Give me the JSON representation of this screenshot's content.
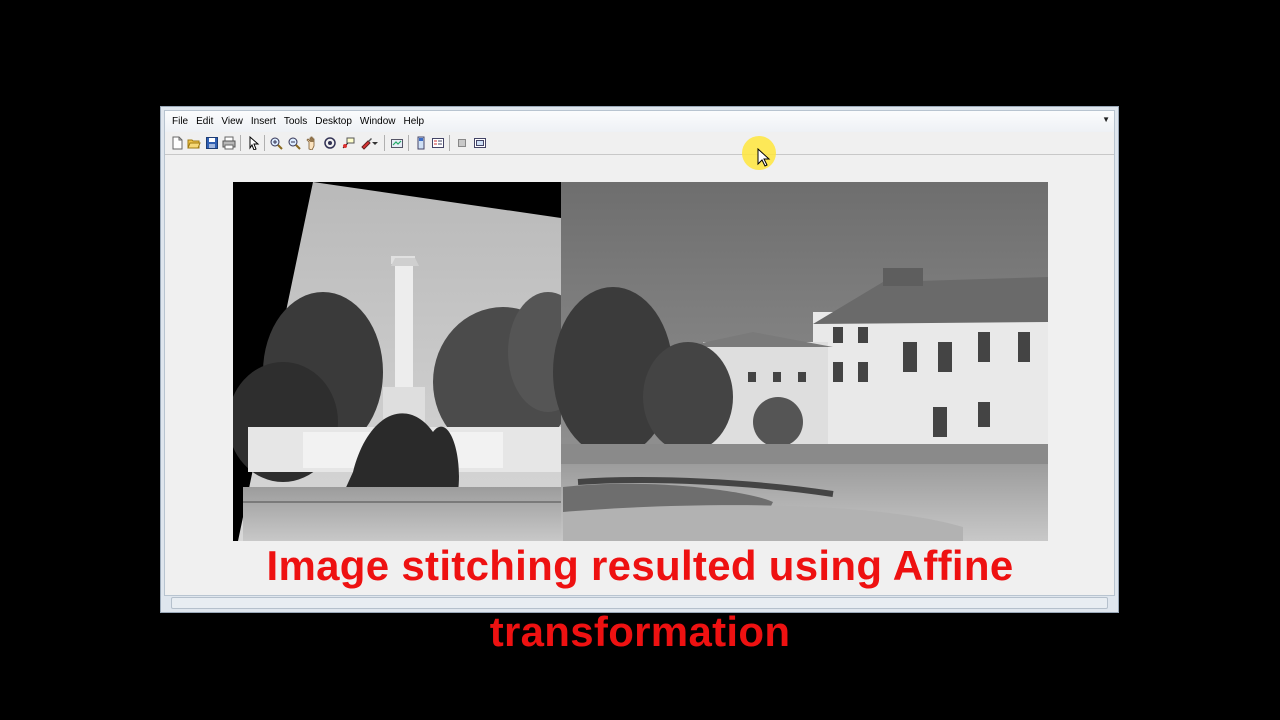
{
  "menubar": {
    "items": [
      "File",
      "Edit",
      "View",
      "Insert",
      "Tools",
      "Desktop",
      "Window",
      "Help"
    ],
    "dock_icon": "dock-arrow-icon"
  },
  "toolbar": {
    "buttons": [
      "new-figure-icon",
      "open-file-icon",
      "save-icon",
      "print-icon",
      "select-arrow-icon",
      "zoom-in-icon",
      "zoom-out-icon",
      "pan-hand-icon",
      "rotate-3d-icon",
      "data-cursor-icon",
      "brush-icon",
      "brush-dropdown-icon",
      "link-plot-icon",
      "colorbar-icon",
      "legend-icon",
      "hide-plot-tools-icon",
      "show-plot-tools-icon"
    ]
  },
  "caption": {
    "line1": "Image stitching resulted  using Affine",
    "line2": "transformation",
    "color": "#ee1111"
  },
  "colors": {
    "window_frame": "#dfe6ee",
    "figure_bg": "#f0f0f0",
    "cursor_highlight": "#ffe63c"
  }
}
